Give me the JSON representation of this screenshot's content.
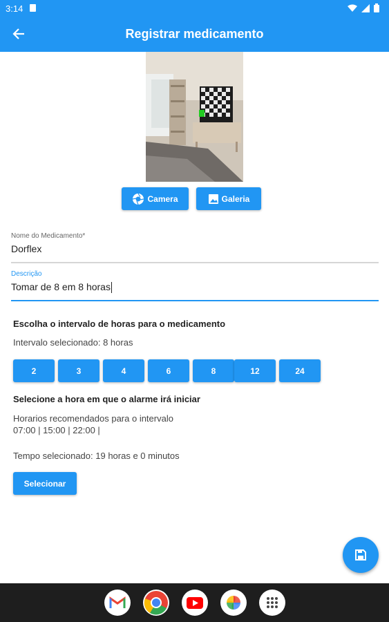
{
  "status_bar": {
    "time": "3:14"
  },
  "app_bar": {
    "title": "Registrar medicamento"
  },
  "photo_buttons": {
    "camera": "Camera",
    "gallery": "Galeria"
  },
  "form": {
    "name_label": "Nome do Medicamento*",
    "name_value": "Dorflex",
    "description_label": "Descrição",
    "description_value": "Tomar de 8 em 8 horas"
  },
  "interval": {
    "title": "Escolha o intervalo de horas para o medicamento",
    "selected_text": "Intervalo selecionado: 8 horas",
    "options": [
      "2",
      "3",
      "4",
      "6",
      "8",
      "12",
      "24"
    ]
  },
  "alarm": {
    "title": "Selecione a hora em que o alarme irá iniciar",
    "recommended_label": "Horarios recomendados para o intervalo",
    "recommended_times": "07:00 | 15:00 | 22:00 |",
    "selected_time": "Tempo selecionado: 19 horas e 0 minutos",
    "select_button": "Selecionar"
  },
  "colors": {
    "primary": "#2196f3",
    "navbar": "#1e1e1e"
  },
  "icons": {
    "back": "arrow-left-icon",
    "camera": "camera-shutter-icon",
    "gallery": "image-icon",
    "fab": "save-icon",
    "dock": [
      "gmail-icon",
      "chrome-icon",
      "youtube-icon",
      "photos-icon",
      "app-drawer-icon"
    ]
  }
}
